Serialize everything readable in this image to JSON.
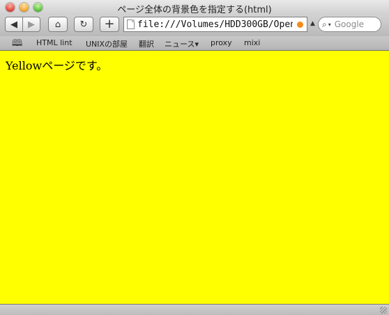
{
  "window": {
    "title": "ページ全体の背景色を指定する(html)"
  },
  "toolbar": {
    "back_icon": "◀",
    "forward_icon": "▶",
    "home_icon": "⌂",
    "reload_icon": "↻",
    "add_icon": "+",
    "url": "file:///Volumes/HDD300GB/OpenSpac",
    "search_placeholder": "Google",
    "search_icon": "magnifier-icon",
    "snap_icon": "▲"
  },
  "bookmarks": {
    "icon": "book-icon",
    "items": [
      {
        "label": "HTML lint"
      },
      {
        "label": "UNIXの部屋"
      },
      {
        "label": "翻訳"
      },
      {
        "label": "ニュース▾"
      },
      {
        "label": "proxy"
      },
      {
        "label": "mixi"
      }
    ]
  },
  "page": {
    "background_color": "#ffff00",
    "text": "Yellowページです。"
  }
}
